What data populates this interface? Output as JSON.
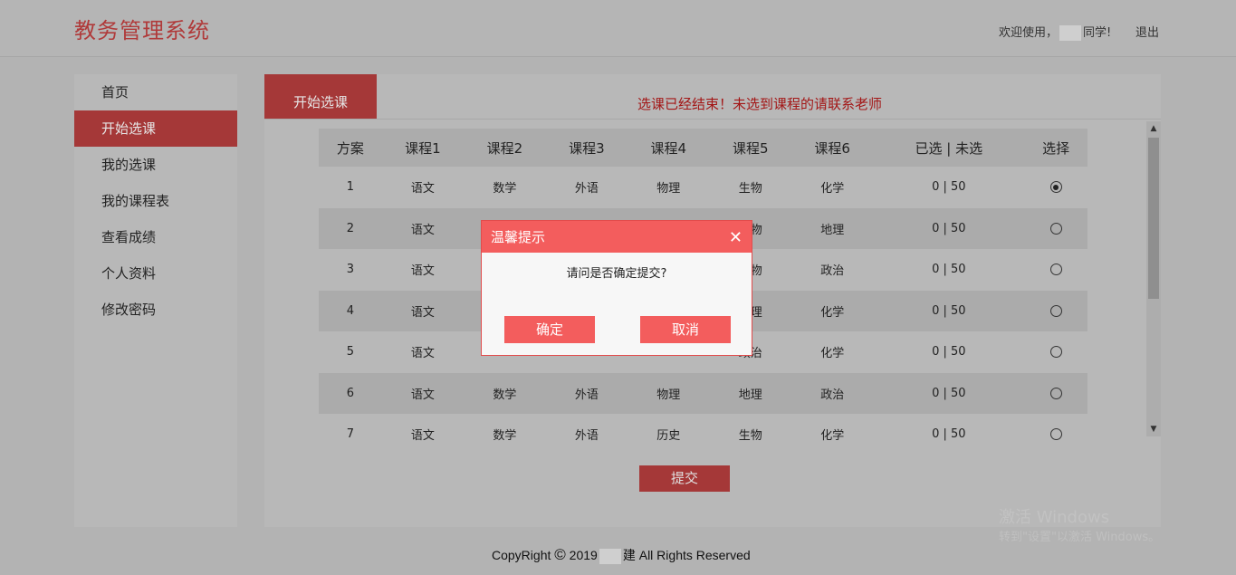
{
  "header": {
    "app_title": "教务管理系统",
    "welcome_prefix": "欢迎使用，",
    "welcome_suffix": "同学!",
    "logout": "退出"
  },
  "sidebar": {
    "items": [
      {
        "label": "首页"
      },
      {
        "label": "开始选课",
        "active": true
      },
      {
        "label": "我的选课"
      },
      {
        "label": "我的课程表"
      },
      {
        "label": "查看成绩"
      },
      {
        "label": "个人资料"
      },
      {
        "label": "修改密码"
      }
    ]
  },
  "main": {
    "tab_label": "开始选课",
    "notice": "选课已经结束！未选到课程的请联系老师",
    "columns": [
      "方案",
      "课程1",
      "课程2",
      "课程3",
      "课程4",
      "课程5",
      "课程6",
      "已选 | 未选",
      "选择"
    ],
    "rows": [
      [
        "1",
        "语文",
        "数学",
        "外语",
        "物理",
        "生物",
        "化学",
        "0 | 50"
      ],
      [
        "2",
        "语文",
        "",
        "",
        "",
        "生物",
        "地理",
        "0 | 50"
      ],
      [
        "3",
        "语文",
        "",
        "",
        "",
        "生物",
        "政治",
        "0 | 50"
      ],
      [
        "4",
        "语文",
        "",
        "",
        "",
        "地理",
        "化学",
        "0 | 50"
      ],
      [
        "5",
        "语文",
        "",
        "",
        "",
        "政治",
        "化学",
        "0 | 50"
      ],
      [
        "6",
        "语文",
        "数学",
        "外语",
        "物理",
        "地理",
        "政治",
        "0 | 50"
      ],
      [
        "7",
        "语文",
        "数学",
        "外语",
        "历史",
        "生物",
        "化学",
        "0 | 50"
      ]
    ],
    "selected_row": 0,
    "submit_label": "提交"
  },
  "dialog": {
    "title": "温馨提示",
    "message": "请问是否确定提交?",
    "ok_label": "确定",
    "cancel_label": "取消"
  },
  "footer": {
    "prefix": "CopyRight ",
    "symbol": "©",
    "year": " 2019",
    "suffix": "建 All Rights Reserved"
  },
  "watermark": {
    "line1": "激活 Windows",
    "line2": "转到\"设置\"以激活 Windows。"
  },
  "colors": {
    "accent": "#a53838",
    "dialog_accent": "#f35d5d",
    "notice": "#a31616"
  }
}
